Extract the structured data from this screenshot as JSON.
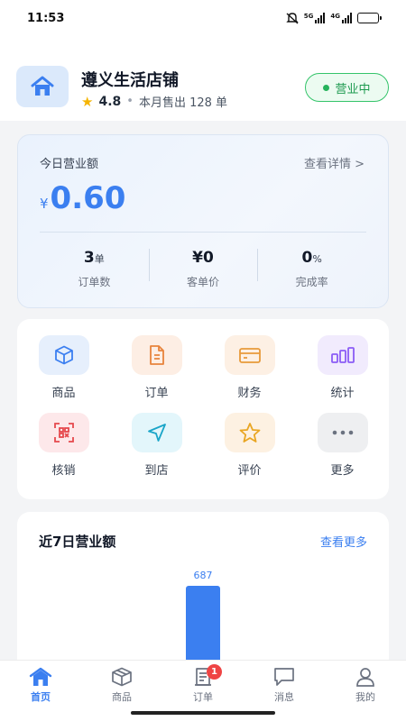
{
  "status_bar": {
    "time": "11:53",
    "signal1": "5G",
    "signal2": "4G"
  },
  "store": {
    "name": "遵义生活店铺",
    "rating": "4.8",
    "monthly_sales": "本月售出 128 单",
    "status": "营业中"
  },
  "revenue": {
    "title": "今日营业额",
    "detail_link": "查看详情 >",
    "currency": "¥",
    "amount": "0.60",
    "stats": [
      {
        "value": "3",
        "unit": "单",
        "label": "订单数"
      },
      {
        "value": "¥0",
        "unit": "",
        "label": "客单价"
      },
      {
        "value": "0",
        "unit": "%",
        "label": "完成率"
      }
    ]
  },
  "functions": [
    {
      "label": "商品",
      "icon": "box-icon"
    },
    {
      "label": "订单",
      "icon": "document-icon"
    },
    {
      "label": "财务",
      "icon": "card-icon"
    },
    {
      "label": "统计",
      "icon": "bar-chart-icon"
    },
    {
      "label": "核销",
      "icon": "qr-scan-icon"
    },
    {
      "label": "到店",
      "icon": "navigation-icon"
    },
    {
      "label": "评价",
      "icon": "star-icon"
    },
    {
      "label": "更多",
      "icon": "more-icon"
    }
  ],
  "weekly": {
    "title": "近7日营业额",
    "more_link": "查看更多"
  },
  "chart_data": {
    "type": "bar",
    "title": "近7日营业额",
    "categories": [],
    "visible_values": [
      687
    ],
    "values": [
      687
    ]
  },
  "tabbar": {
    "items": [
      {
        "label": "首页",
        "icon": "home-icon",
        "active": true
      },
      {
        "label": "商品",
        "icon": "box-icon",
        "active": false
      },
      {
        "label": "订单",
        "icon": "receipt-icon",
        "active": false,
        "badge": "1"
      },
      {
        "label": "消息",
        "icon": "message-icon",
        "active": false
      },
      {
        "label": "我的",
        "icon": "user-icon",
        "active": false
      }
    ]
  },
  "colors": {
    "accent": "#3b7ff0",
    "open_green": "#1d9a4f",
    "badge_red": "#ef4444"
  }
}
